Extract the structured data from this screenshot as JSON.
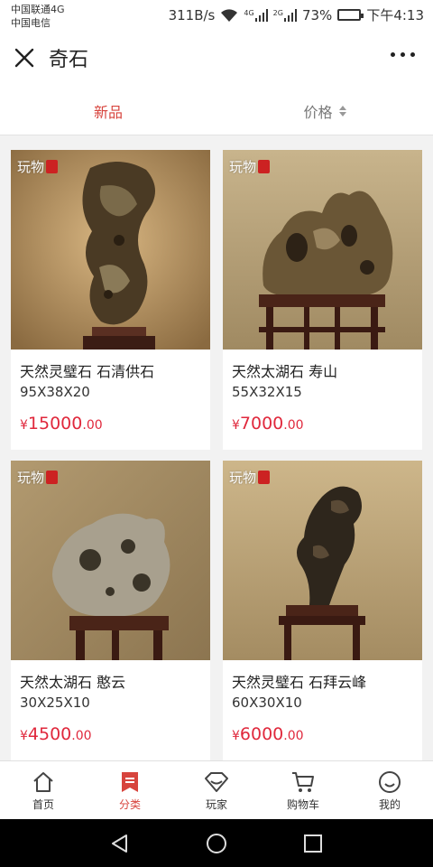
{
  "status": {
    "carrier1": "中国联通4G",
    "carrier2": "中国电信",
    "speed": "311B/s",
    "net1": "4G",
    "net2": "2G",
    "battery": "73%",
    "battery_level": 0.73,
    "time": "下午4:13"
  },
  "appbar": {
    "title": "奇石",
    "close_icon": "close-icon",
    "more_icon": "more-dots-icon"
  },
  "tabs": [
    {
      "label": "新品",
      "active": true
    },
    {
      "label": "价格",
      "active": false,
      "icon": "sort-arrows-icon"
    }
  ],
  "products": [
    {
      "brand": "玩物",
      "name": "天然灵璧石 石清供石",
      "size": "95X38X20",
      "currency": "¥",
      "price_int": "15000",
      "price_dec": ".00"
    },
    {
      "brand": "玩物",
      "name": "天然太湖石 寿山",
      "size": "55X32X15",
      "currency": "¥",
      "price_int": "7000",
      "price_dec": ".00"
    },
    {
      "brand": "玩物",
      "name": "天然太湖石 憨云",
      "size": "30X25X10",
      "currency": "¥",
      "price_int": "4500",
      "price_dec": ".00"
    },
    {
      "brand": "玩物",
      "name": "天然灵璧石 石拜云峰",
      "size": "60X30X10",
      "currency": "¥",
      "price_int": "6000",
      "price_dec": ".00"
    }
  ],
  "bottom_nav": [
    {
      "label": "首页",
      "icon": "home-icon"
    },
    {
      "label": "分类",
      "icon": "category-bookmark-icon",
      "active": true
    },
    {
      "label": "玩家",
      "icon": "players-diamond-icon"
    },
    {
      "label": "购物车",
      "icon": "cart-icon"
    },
    {
      "label": "我的",
      "icon": "smiley-icon"
    }
  ],
  "colors": {
    "accent": "#d7443d",
    "price": "#e0283c"
  }
}
